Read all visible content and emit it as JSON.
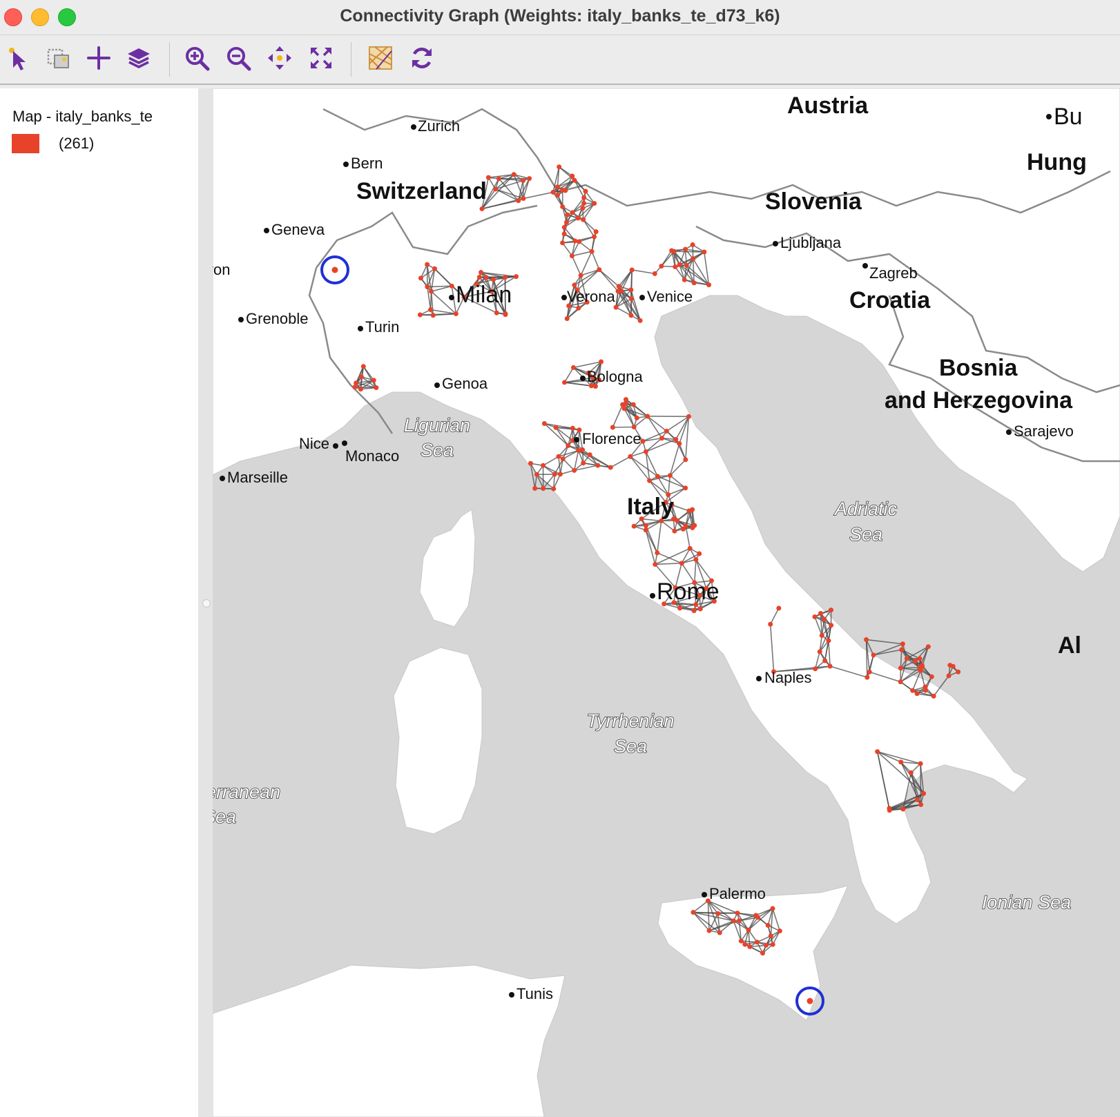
{
  "window": {
    "title": "Connectivity Graph (Weights: italy_banks_te_d73_k6)"
  },
  "toolbar": {
    "tools": [
      {
        "name": "select-tool",
        "icon": "arrow-cursor-icon"
      },
      {
        "name": "layers-select-tool",
        "icon": "select-layers-icon"
      },
      {
        "name": "add-layer-tool",
        "icon": "plus-icon"
      },
      {
        "name": "basemap-layers-tool",
        "icon": "stack-layers-icon"
      },
      {
        "name": "zoom-in-tool",
        "icon": "zoom-in-icon"
      },
      {
        "name": "zoom-out-tool",
        "icon": "zoom-out-icon"
      },
      {
        "name": "pan-tool",
        "icon": "pan-arrows-icon"
      },
      {
        "name": "full-extent-tool",
        "icon": "fit-extent-icon"
      },
      {
        "name": "basemap-tool",
        "icon": "basemap-grid-icon"
      },
      {
        "name": "refresh-tool",
        "icon": "refresh-icon"
      }
    ]
  },
  "legend": {
    "title": "Map - italy_banks_te",
    "count": "(261)",
    "swatch_color": "#e8432a"
  },
  "map": {
    "point_color": "#e8432a",
    "edge_color": "#4a4a4a",
    "highlight_color": "#1f2fd6",
    "sea_color": "#d6d6d6",
    "land_color": "#ffffff",
    "cities": {
      "zurich": "Zurich",
      "bern": "Bern",
      "geneva": "Geneva",
      "lyon": "yon",
      "grenoble": "Grenoble",
      "turin": "Turin",
      "milan": "Milan",
      "verona": "Verona",
      "venice": "Venice",
      "genoa": "Genoa",
      "bologna": "Bologna",
      "florence": "Florence",
      "nice": "Nice",
      "monaco": "Monaco",
      "marseille": "Marseille",
      "rome": "Rome",
      "naples": "Naples",
      "palermo": "Palermo",
      "tunis": "Tunis",
      "ljubljana": "Ljubljana",
      "zagreb": "Zagreb",
      "sarajevo": "Sarajevo",
      "bu": "Bu"
    },
    "countries": {
      "austria": "Austria",
      "switzerland": "Switzerland",
      "slovenia": "Slovenia",
      "croatia": "Croatia",
      "bosnia1": "Bosnia",
      "bosnia2": "and Herzegovina",
      "italy": "Italy",
      "hung": "Hung",
      "al": "Al"
    },
    "seas": {
      "ligurian1": "Ligurian",
      "ligurian2": "Sea",
      "adriatic1": "Adriatic",
      "adriatic2": "Sea",
      "tyrrhenian1": "Tyrrhenian",
      "tyrrhenian2": "Sea",
      "mediterranean1": "erranean",
      "mediterranean2": "Sea",
      "ionian": "Ionian Sea"
    }
  }
}
